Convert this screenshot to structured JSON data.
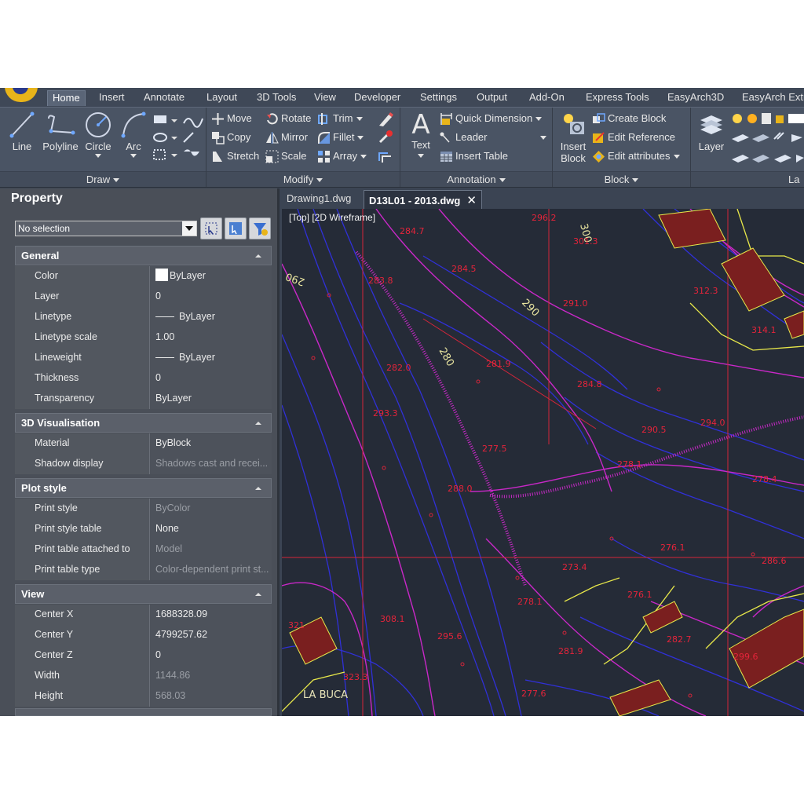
{
  "ribbon_tabs": [
    "Home",
    "Insert",
    "Annotate",
    "Layout",
    "3D Tools",
    "View",
    "Developer",
    "Settings",
    "Output",
    "Add-On",
    "Express Tools",
    "EasyArch3D",
    "EasyArch Extr"
  ],
  "active_tab": "Home",
  "panels": {
    "draw": {
      "title": "Draw",
      "tools": [
        "Line",
        "Polyline",
        "Circle",
        "Arc"
      ]
    },
    "modify": {
      "title": "Modify",
      "tools": [
        "Move",
        "Rotate",
        "Trim",
        "Copy",
        "Mirror",
        "Fillet",
        "Stretch",
        "Scale",
        "Array"
      ]
    },
    "annotation": {
      "title": "Annotation",
      "text": "Text",
      "tools": [
        "Quick Dimension",
        "Leader",
        "Insert Table"
      ]
    },
    "block": {
      "title": "Block",
      "insert_line1": "Insert",
      "insert_line2": "Block",
      "tools": [
        "Create Block",
        "Edit Reference",
        "Edit attributes"
      ]
    },
    "layers": {
      "title": "La",
      "layer": "Layer"
    }
  },
  "palette": {
    "title": "Property",
    "selection": "No selection",
    "sections": {
      "general": {
        "title": "General",
        "rows": [
          {
            "name": "Color",
            "value": "ByLayer"
          },
          {
            "name": "Layer",
            "value": "0"
          },
          {
            "name": "Linetype",
            "value": "ByLayer"
          },
          {
            "name": "Linetype scale",
            "value": "1.00"
          },
          {
            "name": "Lineweight",
            "value": "ByLayer"
          },
          {
            "name": "Thickness",
            "value": "0"
          },
          {
            "name": "Transparency",
            "value": "ByLayer"
          }
        ]
      },
      "visualisation": {
        "title": "3D Visualisation",
        "rows": [
          {
            "name": "Material",
            "value": "ByBlock"
          },
          {
            "name": "Shadow display",
            "value": "Shadows cast and recei..."
          }
        ]
      },
      "plot": {
        "title": "Plot style",
        "rows": [
          {
            "name": "Print style",
            "value": "ByColor"
          },
          {
            "name": "Print style table",
            "value": "None"
          },
          {
            "name": "Print table attached to",
            "value": "Model"
          },
          {
            "name": "Print table type",
            "value": "Color-dependent print st..."
          }
        ]
      },
      "view": {
        "title": "View",
        "rows": [
          {
            "name": "Center X",
            "value": "1688328.09"
          },
          {
            "name": "Center Y",
            "value": "4799257.62"
          },
          {
            "name": "Center Z",
            "value": "0"
          },
          {
            "name": "Width",
            "value": "1144.86"
          },
          {
            "name": "Height",
            "value": "568.03"
          }
        ]
      }
    }
  },
  "doc_tabs": [
    "Drawing1.dwg",
    "D13L01 - 2013.dwg"
  ],
  "active_doc": "D13L01 - 2013.dwg",
  "viewport": {
    "label": "[Top] [2D Wireframe]",
    "contour_labels": [
      "300",
      "290",
      "280",
      "290"
    ],
    "place_label": "LA BUCA",
    "elevations": [
      "296.2",
      "301.3",
      "284.7",
      "284.5",
      "283.8",
      "291.0",
      "312.3",
      "314.1",
      "281.9",
      "284.8",
      "282.0",
      "293.3",
      "290.5",
      "294.0",
      "277.5",
      "278.1",
      "278.4",
      "288.0",
      "276.1",
      "273.4",
      "286.6",
      "276.1",
      "278.1",
      "308.1",
      "295.6",
      "282.7",
      "281.9",
      "299.6",
      "321",
      "323.3",
      "277.6"
    ]
  },
  "colors": {
    "canvas_bg": "#252b37",
    "contour_major": "#c928c8",
    "contour_minor": "#3030d8",
    "elevation_text": "#e5243a",
    "building_fill": "#7a1f1f",
    "boundary": "#e8e84a"
  }
}
